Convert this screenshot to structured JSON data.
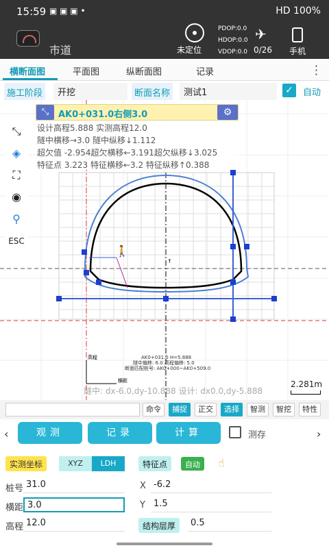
{
  "status": {
    "time": "15:59",
    "right": "HD 100%"
  },
  "header": {
    "title": "巿道",
    "gps": "未定位",
    "dop": [
      "PDOP:0.0",
      "HDOP:0.0",
      "VDOP:0.0"
    ],
    "sat": "0/26",
    "device": "手机"
  },
  "tabs": [
    "横断面图",
    "平面图",
    "纵断面图",
    "记录"
  ],
  "stage": {
    "label": "施工阶段",
    "value": "开挖",
    "section_label": "断面名称",
    "section_value": "测试1",
    "auto": "自动"
  },
  "info": {
    "head": "AK0+031.0右侧3.0",
    "r1": "设计高程5.888 实测高程12.0",
    "r2": "隧中横移→3.0  隧中纵移↓1.112",
    "r3": "超欠值   -2.954超欠横移←3.191超欠纵移↓3.025",
    "r4": "特征点   3.223 特征横移←3.2   特征纵移↑0.388"
  },
  "canvas": {
    "annot": [
      "AK0+031.0 H=5.888",
      "隧中偏移: 6.0 高程偏移: 5.0",
      "断面匹配桩号: AK0+000~AK0+509.0"
    ],
    "footer": "隧中: dx-6.0,dy-10.888 设计: dx0.0,dy-5.888",
    "scale": "2.281m",
    "axis_y": "高程",
    "axis_x": "横距"
  },
  "cmd": [
    "命令",
    "捕捉",
    "正交",
    "选择",
    "智测",
    "智挖",
    "特性"
  ],
  "actions": [
    "观测",
    "记录",
    "计算"
  ],
  "measure_store": "测存",
  "bottom": {
    "coord_label": "实测坐标",
    "xyz": "XYZ",
    "ldh": "LDH",
    "feature": "特征点",
    "auto": "自动",
    "stake_label": "桩号",
    "stake": "31.0",
    "dist_label": "横距",
    "dist": "3.0",
    "elev_label": "高程",
    "elev": "12.0",
    "x_label": "X",
    "x": "-6.2",
    "y_label": "Y",
    "y": "1.5",
    "layer_label": "结构层厚",
    "layer": "0.5"
  }
}
